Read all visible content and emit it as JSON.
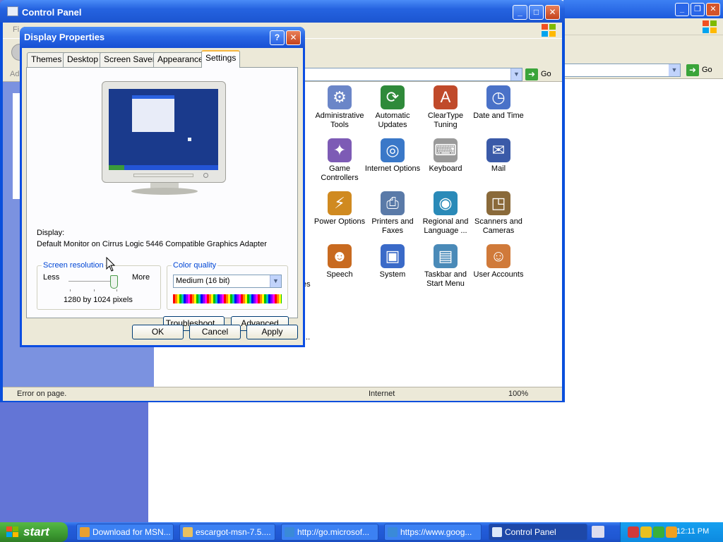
{
  "background_window": {
    "go_label": "Go"
  },
  "control_panel": {
    "title": "Control Panel",
    "menu_first": "Fi",
    "address_short": "Ad",
    "go_label": "Go",
    "status": {
      "left": "Error on page.",
      "zone": "Internet",
      "zoom": "100%"
    },
    "partial_text": {
      "d": "d",
      "es": "es",
      "ellipsis": "..."
    },
    "items": [
      {
        "label": "Administrative Tools",
        "icon": "admin-tools-icon"
      },
      {
        "label": "Automatic Updates",
        "icon": "automatic-updates-icon"
      },
      {
        "label": "ClearType Tuning",
        "icon": "cleartype-icon"
      },
      {
        "label": "Date and Time",
        "icon": "date-time-icon"
      },
      {
        "label": "Game Controllers",
        "icon": "game-controllers-icon"
      },
      {
        "label": "Internet Options",
        "icon": "internet-options-icon"
      },
      {
        "label": "Keyboard",
        "icon": "keyboard-icon"
      },
      {
        "label": "Mail",
        "icon": "mail-icon"
      },
      {
        "label": "Power Options",
        "icon": "power-options-icon"
      },
      {
        "label": "Printers and Faxes",
        "icon": "printers-icon"
      },
      {
        "label": "Regional and Language ...",
        "icon": "regional-icon"
      },
      {
        "label": "Scanners and Cameras",
        "icon": "scanners-icon"
      },
      {
        "label": "Speech",
        "icon": "speech-icon"
      },
      {
        "label": "System",
        "icon": "system-icon"
      },
      {
        "label": "Taskbar and Start Menu",
        "icon": "taskbar-icon"
      },
      {
        "label": "User Accounts",
        "icon": "user-accounts-icon"
      }
    ]
  },
  "dialog": {
    "title": "Display Properties",
    "help_label": "?",
    "close_label": "✕",
    "tabs": [
      "Themes",
      "Desktop",
      "Screen Saver",
      "Appearance",
      "Settings"
    ],
    "active_tab": "Settings",
    "display_label": "Display:",
    "display_value": "Default Monitor on Cirrus Logic 5446 Compatible Graphics Adapter",
    "resolution": {
      "group_title": "Screen resolution",
      "less": "Less",
      "more": "More",
      "value": "1280 by 1024 pixels",
      "slider_level": 1.0
    },
    "color": {
      "group_title": "Color quality",
      "selected": "Medium (16 bit)"
    },
    "buttons": {
      "troubleshoot": "Troubleshoot...",
      "advanced": "Advanced",
      "ok": "OK",
      "cancel": "Cancel",
      "apply": "Apply"
    }
  },
  "taskbar": {
    "start_label": "start",
    "tasks": [
      {
        "label": "Download for MSN...",
        "active": false
      },
      {
        "label": "escargot-msn-7.5....",
        "active": false
      },
      {
        "label": "http://go.microsof...",
        "active": false
      },
      {
        "label": "https://www.goog...",
        "active": false
      },
      {
        "label": "Control Panel",
        "active": true
      }
    ],
    "clock": "12:11 PM"
  },
  "colors": {
    "title_blue": "#245edb",
    "start_green": "#3c9a31",
    "tray_blue": "#0d8ae0",
    "dialog_face": "#ece9d8",
    "desktop_blue": "#6375d6"
  }
}
